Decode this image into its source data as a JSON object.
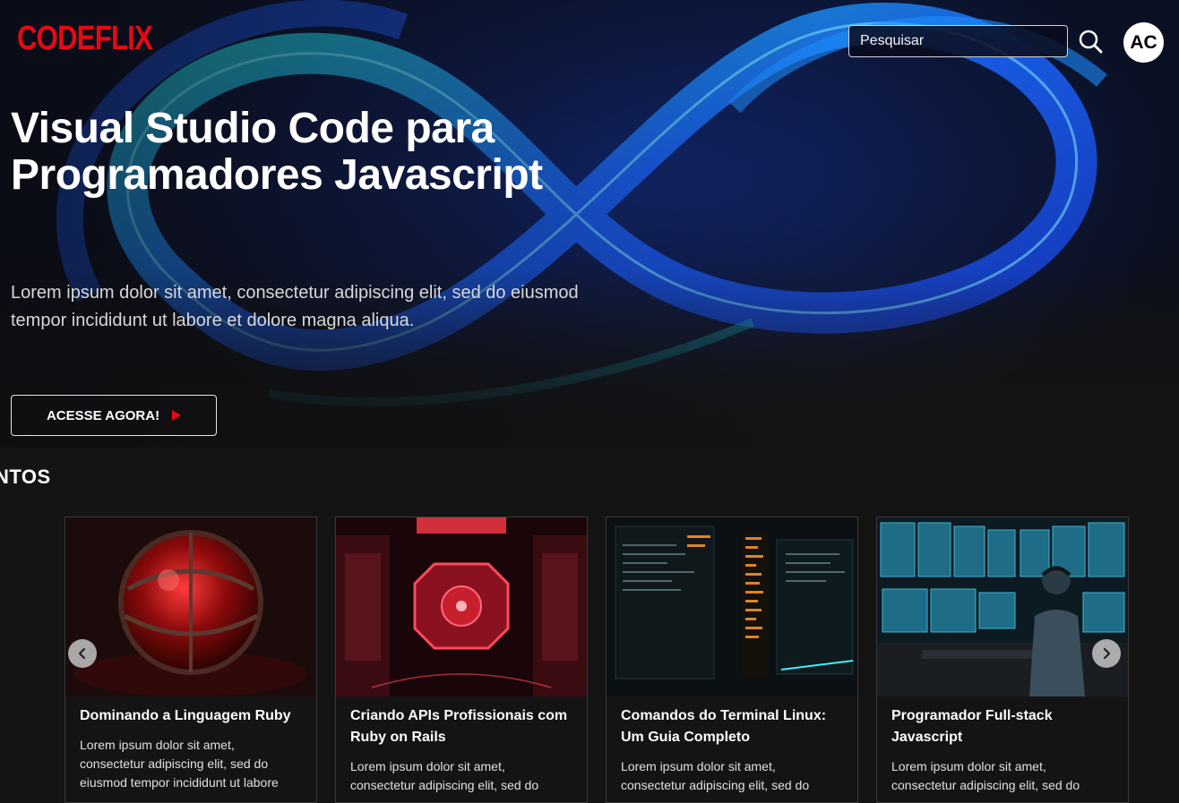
{
  "header": {
    "logo_text": "CODEFLIX",
    "search_placeholder": "Pesquisar",
    "avatar_initials": "AC",
    "brand_color": "#e50914"
  },
  "hero": {
    "title": "Visual Studio Code para Programadores Javascript",
    "description": "Lorem ipsum dolor sit amet, consectetur adipiscing elit, sed do eiusmod tempor incididunt ut labore et dolore magna aliqua.",
    "cta_label": "ACESSE AGORA!",
    "cta_icon": "play-icon"
  },
  "section": {
    "title": "NTOS"
  },
  "carousel": {
    "prev_icon": "chevron-left-icon",
    "next_icon": "chevron-right-icon",
    "cards": [
      {
        "title": "Dominando a Linguagem Ruby",
        "description": "Lorem ipsum dolor sit amet, consectetur adipiscing elit, sed do eiusmod tempor incididunt ut labore",
        "thumb": "red-crystal-sphere"
      },
      {
        "title": "Criando APIs Profissionais com Ruby on Rails",
        "description": "Lorem ipsum dolor sit amet, consectetur adipiscing elit, sed do",
        "thumb": "red-server-room"
      },
      {
        "title": "Comandos do Terminal Linux: Um Guia Completo",
        "description": "Lorem ipsum dolor sit amet, consectetur adipiscing elit, sed do",
        "thumb": "terminal-code-screens"
      },
      {
        "title": "Programador Full-stack Javascript",
        "description": "Lorem ipsum dolor sit amet, consectetur adipiscing elit, sed do",
        "thumb": "developer-monitors"
      }
    ]
  }
}
